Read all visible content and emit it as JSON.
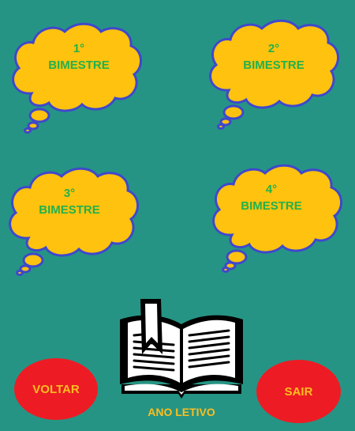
{
  "bimesters": [
    {
      "number": "1°",
      "label": "BIMESTRE"
    },
    {
      "number": "2°",
      "label": "BIMESTRE"
    },
    {
      "number": "3°",
      "label": "BIMESTRE"
    },
    {
      "number": "4°",
      "label": "BIMESTRE"
    }
  ],
  "buttons": {
    "back": "VOLTAR",
    "exit": "SAIR"
  },
  "book": {
    "label": "ANO LETIVO",
    "icon": "open-book-icon"
  },
  "colors": {
    "background": "#269484",
    "cloud_fill": "#ffc20e",
    "cloud_border": "#3f48cc",
    "cloud_text": "#22b14c",
    "button_fill": "#ed1c24",
    "button_text": "#fdbe1f"
  }
}
